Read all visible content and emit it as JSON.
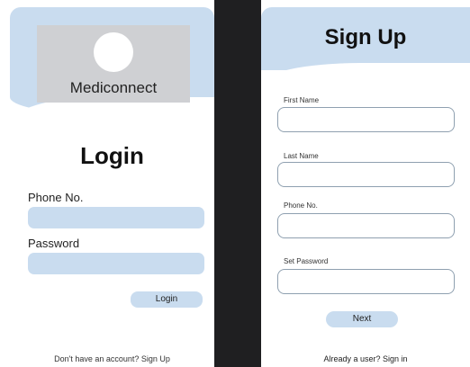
{
  "login": {
    "brand": "Mediconnect",
    "title": "Login",
    "phone_label": "Phone No.",
    "phone_value": "",
    "password_label": "Password",
    "password_value": "",
    "login_button": "Login",
    "footer": "Don't have an account? Sign Up"
  },
  "signup": {
    "title": "Sign Up",
    "first_name_label": "First Name",
    "last_name_label": "Last Name",
    "phone_label": "Phone No.",
    "password_label": "Set Password",
    "next_button": "Next",
    "footer": "Already a user? Sign in"
  },
  "colors": {
    "accent": "#c9dcef",
    "logo_box": "#cfd0d3",
    "divider": "#1f1f21",
    "field_border": "#8fa0b0"
  }
}
